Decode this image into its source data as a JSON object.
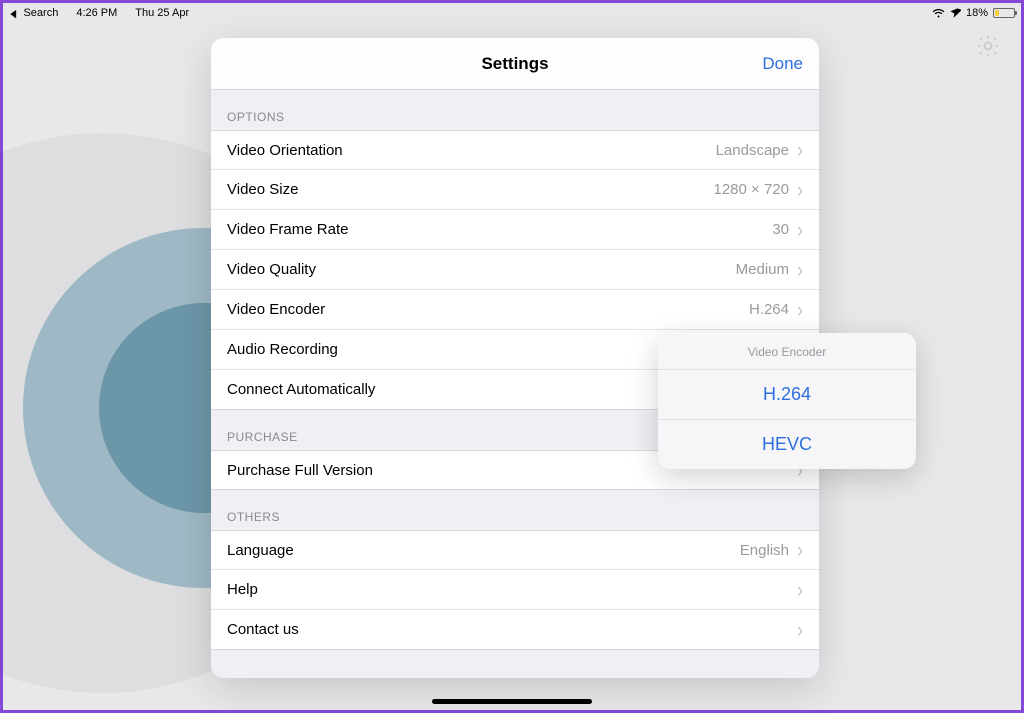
{
  "status": {
    "back_app": "Search",
    "time": "4:26 PM",
    "date": "Thu 25 Apr",
    "battery_pct": "18%",
    "battery_fill_pct": 18
  },
  "sheet": {
    "title": "Settings",
    "done": "Done",
    "sections": {
      "options_header": "OPTIONS",
      "purchase_header": "PURCHASE",
      "others_header": "OTHERS"
    },
    "rows": {
      "video_orientation": {
        "label": "Video Orientation",
        "value": "Landscape"
      },
      "video_size": {
        "label": "Video Size",
        "value": "1280 × 720"
      },
      "video_frame_rate": {
        "label": "Video Frame Rate",
        "value": "30"
      },
      "video_quality": {
        "label": "Video Quality",
        "value": "Medium"
      },
      "video_encoder": {
        "label": "Video Encoder",
        "value": "H.264"
      },
      "audio_recording": {
        "label": "Audio Recording",
        "value": ""
      },
      "connect_auto": {
        "label": "Connect Automatically",
        "value": ""
      },
      "purchase_full": {
        "label": "Purchase Full Version",
        "value": ""
      },
      "language": {
        "label": "Language",
        "value": "English"
      },
      "help": {
        "label": "Help",
        "value": ""
      },
      "contact_us": {
        "label": "Contact us",
        "value": ""
      }
    }
  },
  "popover": {
    "title": "Video Encoder",
    "options": [
      "H.264",
      "HEVC"
    ]
  }
}
